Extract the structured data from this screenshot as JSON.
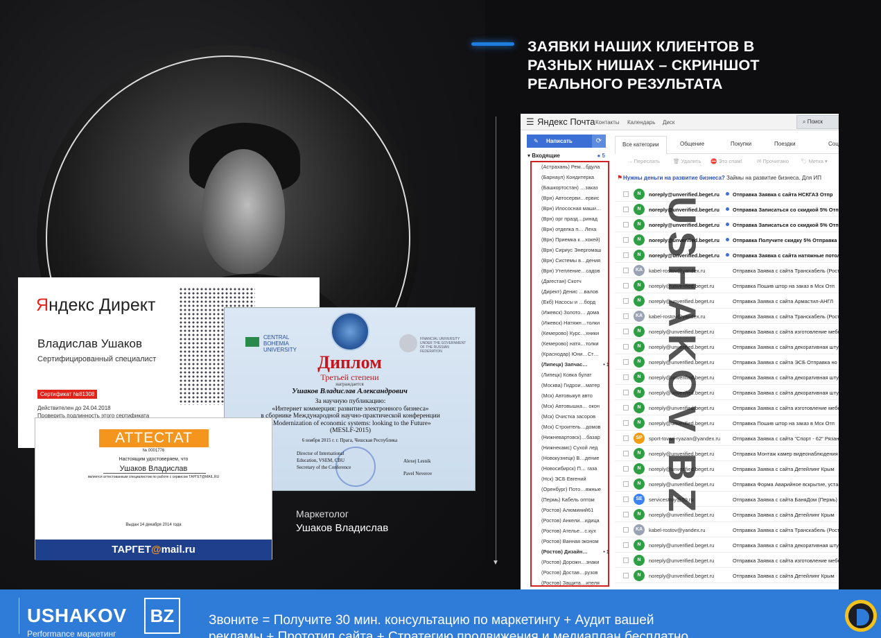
{
  "headline": {
    "line1": "ЗАЯВКИ НАШИХ КЛИЕНТОВ В",
    "line2": "РАЗНЫХ НИШАХ – СКРИНШОТ",
    "line3": "РЕАЛЬНОГО РЕЗУЛЬТАТА"
  },
  "person": {
    "role": "Маркетолог",
    "name": "Ушаков Владислав"
  },
  "cert_yandex": {
    "logo_first": "Я",
    "logo_rest": "ндекс Директ",
    "name": "Владислав Ушаков",
    "role": "Сертифицированный специалист",
    "number": "Сертификат №81308",
    "valid_line1": "Действителен до 24.04.2018",
    "valid_line2": "Проверить подлинность этого сертификата"
  },
  "cert_diploma": {
    "cbu_line1": "CENTRAL",
    "cbu_line2": "BOHEMIA",
    "cbu_line3": "UNIVERSITY",
    "right_logo_text": "FINANCIAL UNIVERSITY UNDER THE GOVERNMENT OF THE RUSSIAN FEDERATION",
    "title": "Диплом",
    "degree": "Третьей степени",
    "award": "награждается",
    "person": "Ушаков Владислав Александрович",
    "body_line1": "За научную публикацию:",
    "body_line2": "«Интернет коммерция: развитие электронного бизнеса»",
    "body_line3": "в сборнике Международной научно-практической конференции",
    "body_line4": "«Modernization of economic systems: looking to the Future»",
    "body_line5": "(MESLF-2015)",
    "date": "6 ноября 2015 г. г. Прага, Чешская Республика",
    "left_sig_line1": "Director of International",
    "left_sig_line2": "Education, VSEM, CBU",
    "left_sig_line3": "Secretary of the Conference",
    "right_sig_line1": "Alexej Lesnik",
    "right_sig_line2": "Pavel Neverov"
  },
  "cert_attestat": {
    "head": "АТТЕСТАТ",
    "number": "№ 0001776",
    "certify": "Настоящим удостоверяем, что",
    "name": "Ушаков Владислав",
    "desc": "является аттестованным специалистом по работе с сервисом ТАРГЕТ@MAIL.RU",
    "date": "Выдан  14 декабря 2014 года",
    "foot_before": "ТАРГЕТ",
    "foot_at": "@",
    "foot_after": "mail.ru"
  },
  "mail": {
    "menu_icon": "☰",
    "logo": "Яндекс Почта",
    "nav": [
      "Контакты",
      "Календарь",
      "Диск"
    ],
    "search": "Поиск",
    "compose": "Написать",
    "inbox": "▾ Входящие",
    "inbox_count": "● 5",
    "tabs": [
      "Все категории",
      "Общение",
      "Покупки",
      "Поездки",
      "Соц"
    ],
    "toolbar": [
      "→ Переслать",
      "🗑 Удалить",
      "⛔ Это спам!",
      "✉ Прочитано",
      "🏷 Метка ▾"
    ],
    "promo_bold": "Нужны деньги на развитие бизнеса?",
    "promo_rest": " Займы на развитие бизнеса. Для ИП",
    "folders": [
      "(Астрахань) Рем…бдула",
      "(Барнаул) Кондитерка",
      "(Башкортостан) …заказ",
      "(Врн) Автосерви…ервис",
      "(Врн) Илососная маши…",
      "(Врн) орг празд…ринад",
      "(Врн) отделка п…  Леха",
      "(Врн) Приемка к…хокей)",
      "(Врн) Сириус Энергомаш",
      "(Врн) Системы в…дения",
      "(Врн) Утепление…садов",
      "(Дагестан) Скотч",
      "(Директ) Денис …валов",
      "(Екб) Насосы и …борд",
      "(Ижевск) Золото…  дома",
      "(Ижевск) Натяжн…толки",
      "(Кемерово) Курс…хники",
      "(Кемерово) натя…толки",
      "(Краснодар) Юни…Ст…",
      "(Липецк) Запчас…",
      "(Липецк) Ковка булат",
      "(Москва) Гидрои…матер",
      "(Мск) Автовыкуп авто",
      "(Мск) Автовышка…  окон",
      "(Мск) Очистка засоров",
      "(Мск) Строитель…домов",
      "(Нижневартовск)…базар",
      "(Нижнекамс) Сухой лед",
      "(Новокузнецк) В…дение",
      "(Новосибирск) П…  газа",
      "(Нск) ЭСБ Евгений",
      "(Оренбург) Пото…яжные",
      "(Пермь) Кабель оптом",
      "(Ростов) Алюминий61",
      "(Ростов) Анкели…идица",
      "(Ростов) Ателье…с.кух",
      "(Ростов) Ванная эконом",
      "(Ростов) Дизайн…",
      "(Ростов) Дорожн…знаки",
      "(Ростов) Достав…рузов",
      "(Ростов) Защита…ителя"
    ],
    "folder_badge": "• 1",
    "rows": [
      {
        "av": "N",
        "color": "#2ea043",
        "from": "noreply@unverified.beget.ru",
        "subj": "Отправка Заявка с сайта НСКГАЗ  Отпр",
        "unread": true
      },
      {
        "av": "N",
        "color": "#2ea043",
        "from": "noreply@unverified.beget.ru",
        "subj": "Отправка Записаться со скидкой 5%  Отп",
        "unread": true
      },
      {
        "av": "N",
        "color": "#2ea043",
        "from": "noreply@unverified.beget.ru",
        "subj": "Отправка Записаться со скидкой 5%  Отп",
        "unread": true
      },
      {
        "av": "N",
        "color": "#2ea043",
        "from": "noreply@unverified.beget.ru",
        "subj": "Отправка Получите скидку 5%  Отправка",
        "unread": true
      },
      {
        "av": "N",
        "color": "#2ea043",
        "from": "noreply@unverified.beget.ru",
        "subj": "Отправка Заявка с сайта натяжные потол",
        "unread": true
      },
      {
        "av": "KA",
        "color": "#9aa3b5",
        "from": "kabel-rostov@yandex.ru",
        "subj": "Отправка Заявка с сайта Транскабель (Рост",
        "unread": false
      },
      {
        "av": "N",
        "color": "#2ea043",
        "from": "noreply@unverified.beget.ru",
        "subj": "Отправка Пошив штор на заказ в Мск  Отп",
        "unread": false
      },
      {
        "av": "N",
        "color": "#2ea043",
        "from": "noreply@unverified.beget.ru",
        "subj": "Отправка Заявка с сайта Армастил-АНГЛ",
        "unread": false
      },
      {
        "av": "KA",
        "color": "#9aa3b5",
        "from": "kabel-rostov@yandex.ru",
        "subj": "Отправка Заявка с сайта Транскабель (Рост",
        "unread": false
      },
      {
        "av": "N",
        "color": "#2ea043",
        "from": "noreply@unverified.beget.ru",
        "subj": "Отправка Заявка с сайта изготовление мебе",
        "unread": false
      },
      {
        "av": "N",
        "color": "#2ea043",
        "from": "noreply@unverified.beget.ru",
        "subj": "Отправка Заявка с сайта декоративная штук",
        "unread": false
      },
      {
        "av": "N",
        "color": "#2ea043",
        "from": "noreply@unverified.beget.ru",
        "subj": "Отправка Заявка с сайта ЭСБ  Отправка но",
        "unread": false
      },
      {
        "av": "N",
        "color": "#2ea043",
        "from": "noreply@unverified.beget.ru",
        "subj": "Отправка Заявка с сайта декоративная штук",
        "unread": false
      },
      {
        "av": "N",
        "color": "#2ea043",
        "from": "noreply@unverified.beget.ru",
        "subj": "Отправка Заявка с сайта декоративная штук",
        "unread": false
      },
      {
        "av": "N",
        "color": "#2ea043",
        "from": "noreply@unverified.beget.ru",
        "subj": "Отправка Заявка с сайта изготовление мебе",
        "unread": false
      },
      {
        "av": "N",
        "color": "#2ea043",
        "from": "noreply@unverified.beget.ru",
        "subj": "Отправка Пошив штор на заказ в Мск  Отп",
        "unread": false
      },
      {
        "av": "SP",
        "color": "#f39c12",
        "from": "sport-tovari-ryazan@yandex.ru",
        "subj": "Отправка Заявка с сайта \"Спорт - 62\" Рязан",
        "unread": false
      },
      {
        "av": "N",
        "color": "#2ea043",
        "from": "noreply@unverified.beget.ru",
        "subj": "Отправка Монтаж камер видеонаблюдения в",
        "unread": false
      },
      {
        "av": "N",
        "color": "#2ea043",
        "from": "noreply@unverified.beget.ru",
        "subj": "Отправка Заявка с сайта Детейлинг Крым",
        "unread": false
      },
      {
        "av": "N",
        "color": "#2ea043",
        "from": "noreply@unverified.beget.ru",
        "subj": "Отправка Форма Аварийное вскрытие, устан",
        "unread": false
      },
      {
        "av": "SE",
        "color": "#3b82f6",
        "from": "servicestroy@59.ru",
        "subj": "Отправка Заявка с сайта БаняДом (Пермь)",
        "unread": false
      },
      {
        "av": "N",
        "color": "#2ea043",
        "from": "noreply@unverified.beget.ru",
        "subj": "Отправка Заявка с сайта Детейлинг Крым",
        "unread": false
      },
      {
        "av": "KA",
        "color": "#9aa3b5",
        "from": "kabel-rostov@yandex.ru",
        "subj": "Отправка Заявка с сайта Транскабель (Рост",
        "unread": false
      },
      {
        "av": "N",
        "color": "#2ea043",
        "from": "noreply@unverified.beget.ru",
        "subj": "Отправка Заявка с сайта декоративная штук",
        "unread": false
      },
      {
        "av": "N",
        "color": "#2ea043",
        "from": "noreply@unverified.beget.ru",
        "subj": "Отправка Заявка с сайта изготовление мебе",
        "unread": false
      },
      {
        "av": "N",
        "color": "#2ea043",
        "from": "noreply@unverified.beget.ru",
        "subj": "Отправка Заявка с сайта Детейлинг Крым",
        "unread": false
      }
    ]
  },
  "watermark": "USHAKOV.BZ",
  "bottom": {
    "brand": "USHAKOV",
    "brand_bz": "BZ",
    "brand_sub": "Performance маркетинг",
    "cta_line1": "Звоните = Получите 30 мин. консультацию по маркетингу + Аудит вашей",
    "cta_line2": "рекламы + Прототип сайта + Стратегию продвижения и медиаплан бесплатно"
  },
  "colors": {
    "accent": "#1f7ce0",
    "bottom_bar": "#2f7bd8",
    "diploma_red": "#c4161c",
    "attestat_orange": "#f4961e"
  }
}
